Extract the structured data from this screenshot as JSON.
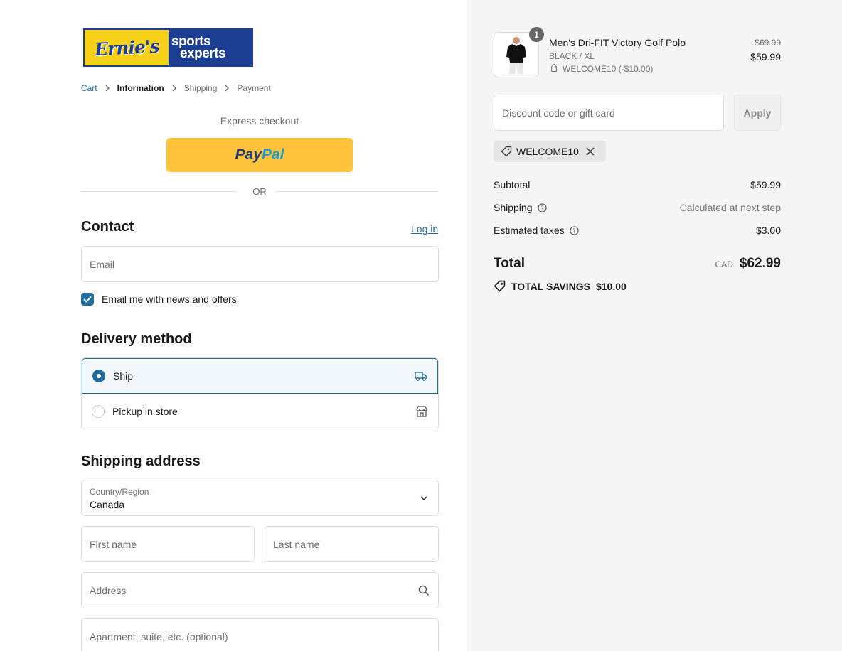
{
  "brand": {
    "name_part1": "Ernie's",
    "name_part2a": "sports",
    "name_part2b": "experts"
  },
  "breadcrumb": {
    "cart": "Cart",
    "information": "Information",
    "shipping": "Shipping",
    "payment": "Payment"
  },
  "express": {
    "label": "Express checkout",
    "paypal_a": "Pay",
    "paypal_b": "Pal",
    "or": "OR"
  },
  "contact": {
    "title": "Contact",
    "login": "Log in",
    "email_placeholder": "Email",
    "newsletter_label": "Email me with news and offers",
    "newsletter_checked": true
  },
  "delivery": {
    "title": "Delivery method",
    "options": [
      {
        "label": "Ship",
        "selected": true
      },
      {
        "label": "Pickup in store",
        "selected": false
      }
    ]
  },
  "shipping_address": {
    "title": "Shipping address",
    "country_label": "Country/Region",
    "country_value": "Canada",
    "first_name_placeholder": "First name",
    "last_name_placeholder": "Last name",
    "address_placeholder": "Address",
    "apartment_placeholder": "Apartment, suite, etc. (optional)"
  },
  "order": {
    "item": {
      "quantity": "1",
      "name": "Men's Dri-FIT Victory Golf Polo",
      "variant": "BLACK / XL",
      "discount": "WELCOME10 (-$10.00)",
      "price_original": "$69.99",
      "price": "$59.99"
    },
    "discount_placeholder": "Discount code or gift card",
    "apply_label": "Apply",
    "applied_code": "WELCOME10",
    "subtotal_label": "Subtotal",
    "subtotal_value": "$59.99",
    "shipping_label": "Shipping",
    "shipping_value": "Calculated at next step",
    "taxes_label": "Estimated taxes",
    "taxes_value": "$3.00",
    "total_label": "Total",
    "currency": "CAD",
    "total_value": "$62.99",
    "savings_label": "TOTAL SAVINGS",
    "savings_value": "$10.00"
  },
  "colors": {
    "accent": "#1f6d9e",
    "paypal_yellow": "#ffc439",
    "summary_bg": "#f5f5f5"
  },
  "icons": [
    "chevron-right-icon",
    "truck-icon",
    "store-icon",
    "chevron-down-icon",
    "search-icon",
    "tag-icon",
    "close-icon",
    "info-icon",
    "check-icon"
  ]
}
